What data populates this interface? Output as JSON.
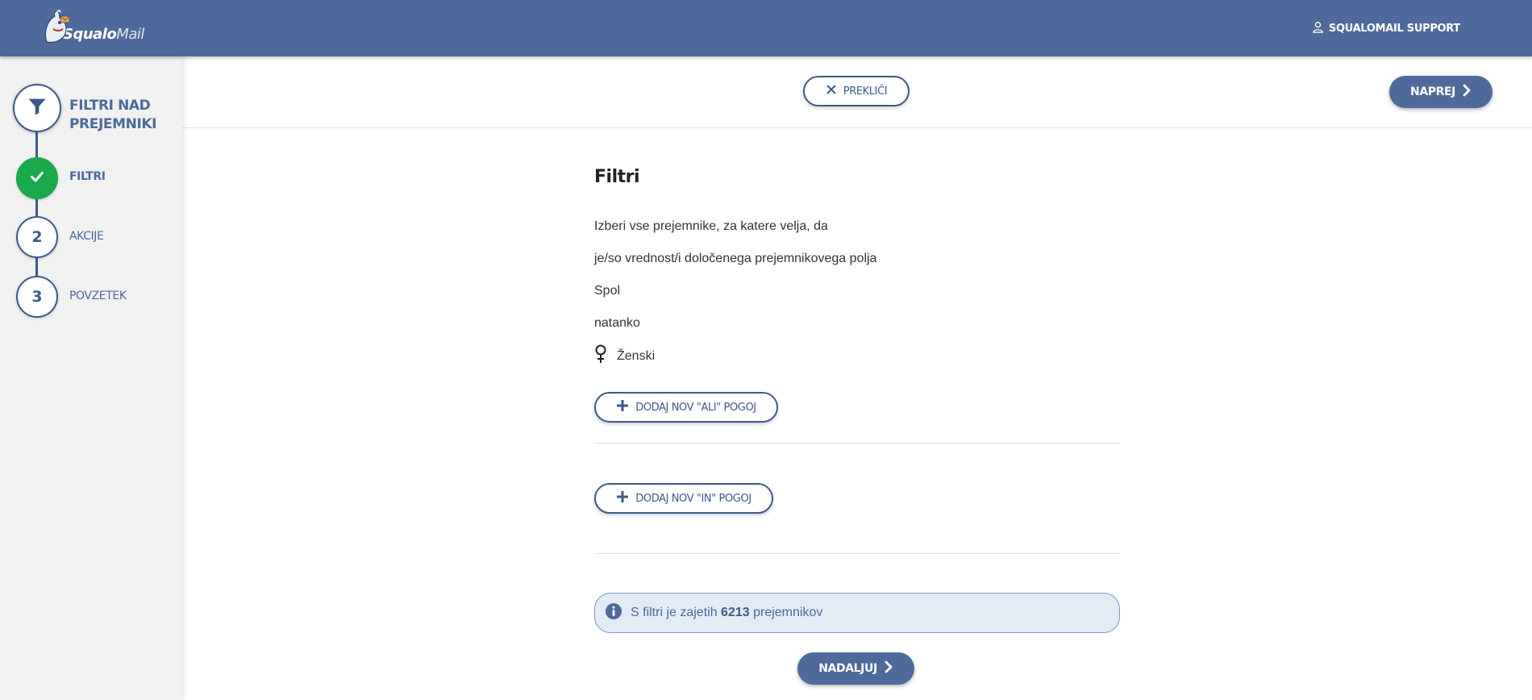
{
  "header": {
    "logo_bold": "Squalo",
    "logo_light": "Mail",
    "user_label": "SQUALOMAIL SUPPORT",
    "user_icon": "user-icon"
  },
  "sidebar": {
    "title": "FILTRI NAD PREJEMNIKI",
    "title_icon": "filter-icon",
    "steps": [
      {
        "label": "FILTRI",
        "status": "done",
        "icon": "check-icon"
      },
      {
        "number": "2",
        "label": "AKCIJE"
      },
      {
        "number": "3",
        "label": "POVZETEK"
      }
    ]
  },
  "actions": {
    "cancel_label": "PREKLIČI",
    "next_label": "NAPREJ"
  },
  "main": {
    "heading": "Filtri",
    "lines": [
      "Izberi vse prejemnike, za katere velja, da",
      "je/so vrednost/i določenega prejemnikovega polja",
      "Spol",
      "natanko"
    ],
    "gender_value": "Ženski",
    "gender_icon": "female-icon",
    "add_or_label": "DODAJ NOV \"ALI\" POGOJ",
    "add_and_label": "DODAJ NOV \"IN\" POGOJ",
    "info_prefix": "S filtri je zajetih",
    "info_count": "6213",
    "info_suffix": "prejemnikov",
    "continue_label": "NADALJUJ"
  },
  "colors": {
    "brand": "#4d6a9a",
    "success": "#1aa84a",
    "info_bg": "#e3ebf5"
  }
}
